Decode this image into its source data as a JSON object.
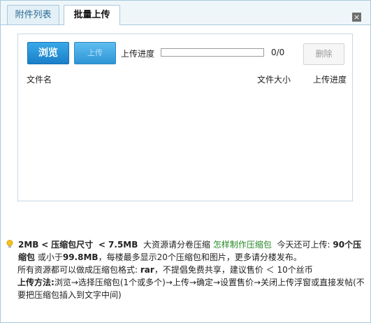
{
  "tabs": [
    {
      "label": "附件列表",
      "active": false
    },
    {
      "label": "批量上传",
      "active": true
    }
  ],
  "close_label": "×",
  "toolbar": {
    "browse_label": "浏览",
    "upload_label": "上传",
    "progress_label": "上传进度",
    "progress_fraction": 0,
    "progress_count": "0/0",
    "delete_label": "删除"
  },
  "file_table": {
    "columns": [
      "文件名",
      "文件大小",
      "上传进度"
    ],
    "rows": []
  },
  "info": {
    "size_min": "2MB",
    "size_lt": "<",
    "size_label": "压缩包尺寸",
    "size_lt2": "< 7.5MB",
    "split_text": "大资源请分卷压缩",
    "howto_link": "怎样制作压缩包",
    "remaining_prefix": "今天还可上传:",
    "remaining_count": "90个压缩包",
    "or_text": "或小于",
    "remaining_size": "99.8MB",
    "per_floor_text": "，每楼最多显示20个压缩包和图片，更多请分楼发布。",
    "format_prefix": "所有资源都可以做成压缩包格式:",
    "format_value": "rar",
    "share_text": "，不提倡免费共享，建议售价 ＜ 10个丝币",
    "method_label": "上传方法:",
    "method_text": "浏览→选择压缩包(1个或多个)→上传→确定→设置售价→关闭上传浮窗或直接发帖(不要把压缩包插入到文字中间)"
  },
  "colors": {
    "accent": "#1a7fc8",
    "link": "#2a8a2a",
    "border": "#a9c9dc"
  }
}
